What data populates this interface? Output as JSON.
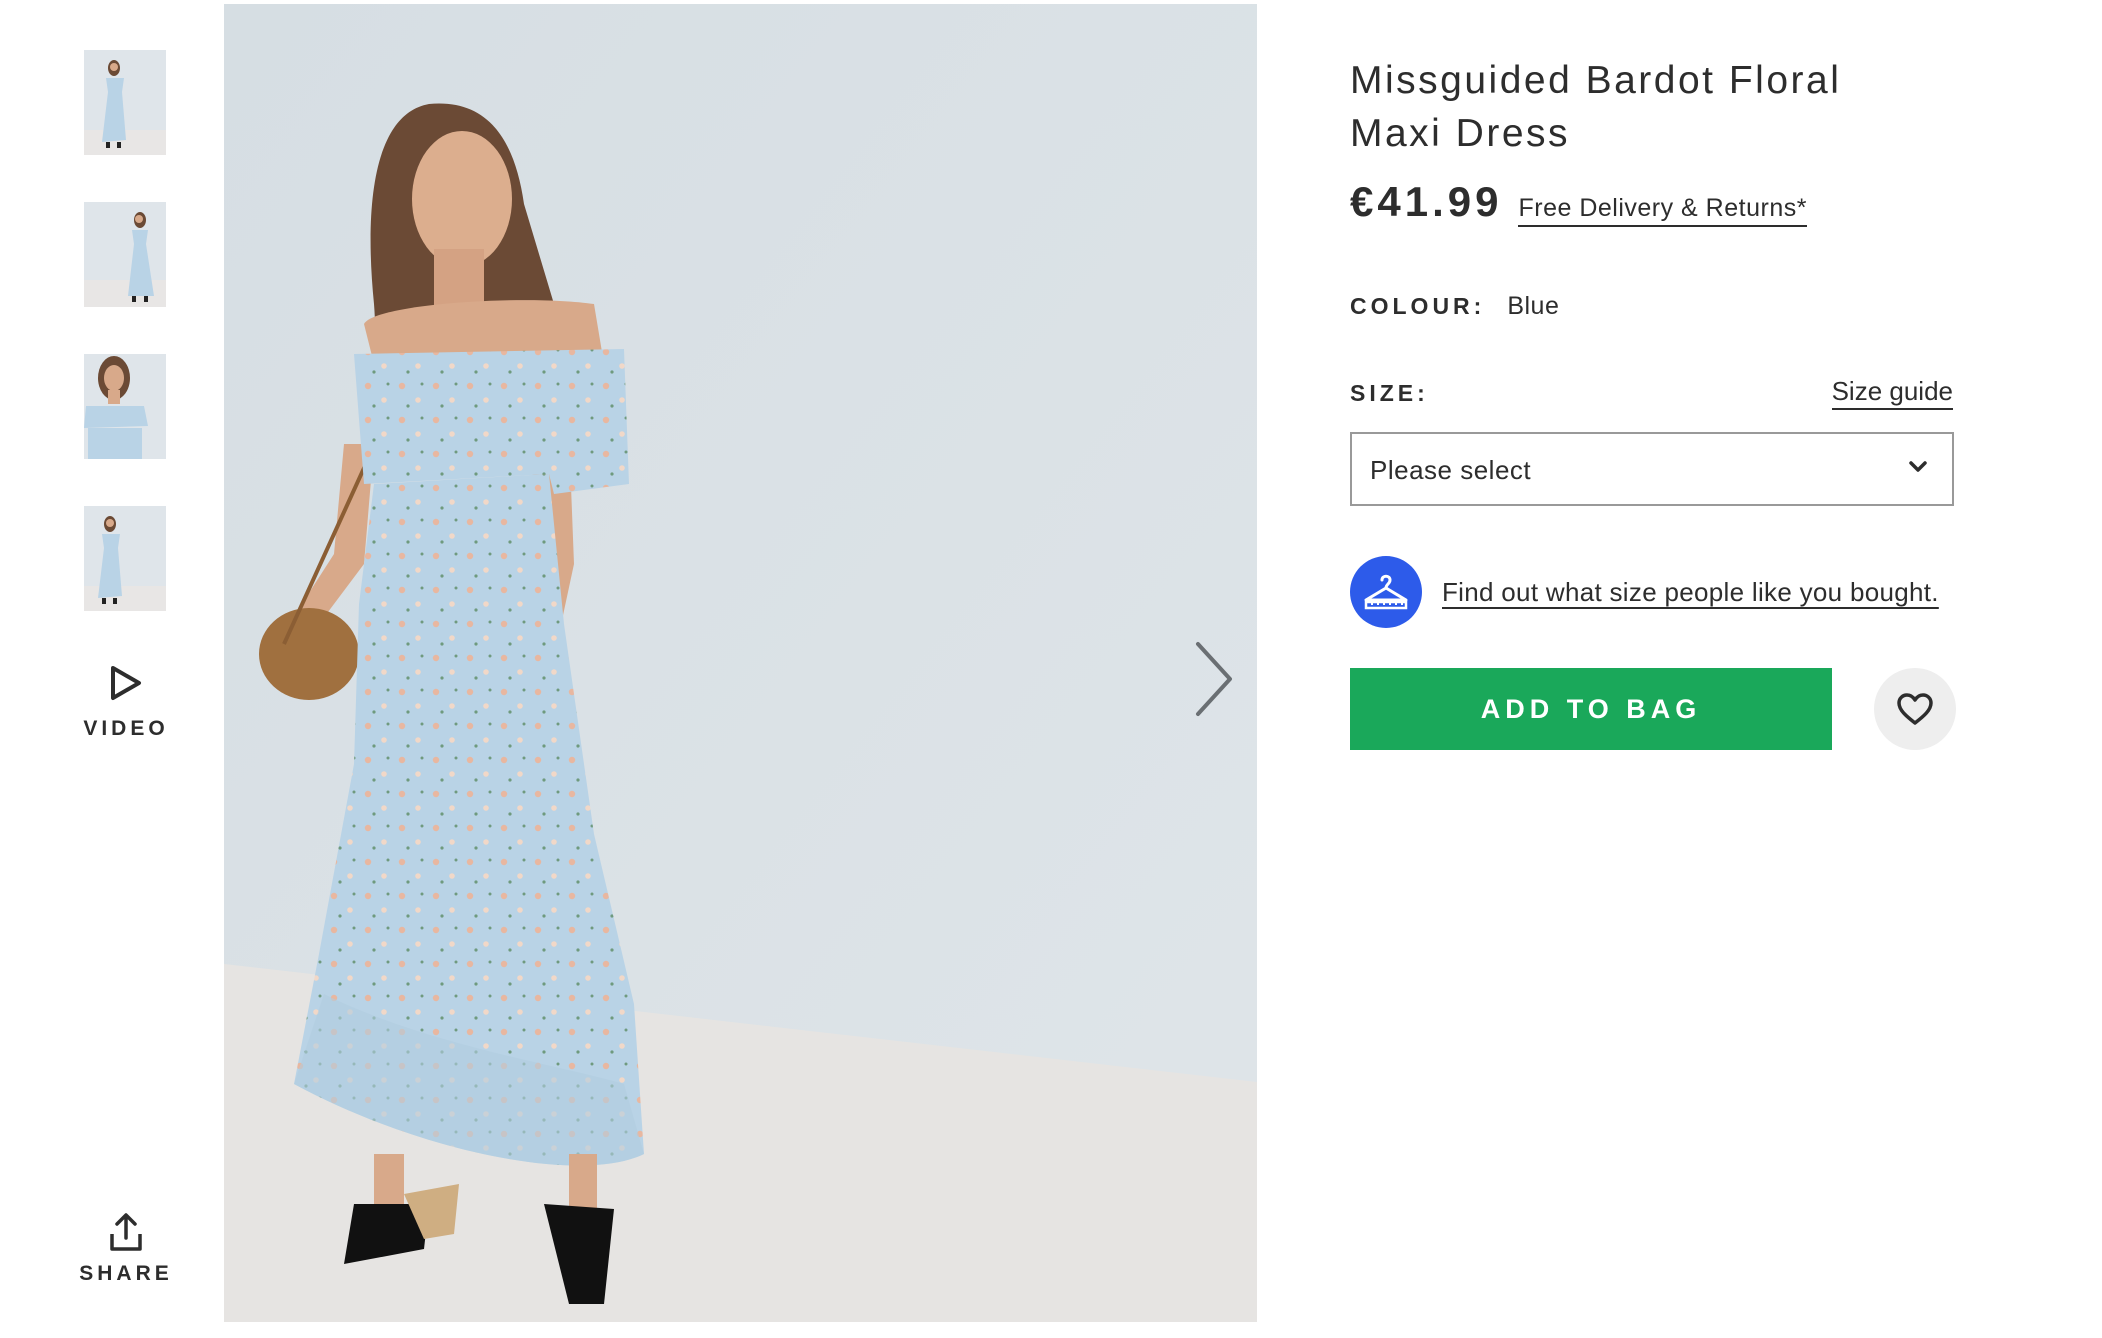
{
  "gallery": {
    "thumbnails": [
      {
        "alt": "thumbnail-1"
      },
      {
        "alt": "thumbnail-2"
      },
      {
        "alt": "thumbnail-3"
      },
      {
        "alt": "thumbnail-4"
      }
    ],
    "video_label": "VIDEO",
    "share_label": "SHARE",
    "video_icon": "play-icon",
    "share_icon": "share-icon",
    "next_icon": "chevron-right-icon"
  },
  "product": {
    "title": "Missguided Bardot Floral Maxi Dress",
    "price": "€41.99",
    "delivery_link": "Free Delivery & Returns*",
    "colour_label": "COLOUR:",
    "colour_value": "Blue",
    "size_label": "SIZE:",
    "size_guide_label": "Size guide",
    "size_placeholder": "Please select",
    "fit_link": "Find out what size people like you bought.",
    "fit_icon": "hanger-icon",
    "add_to_bag_label": "ADD TO BAG",
    "save_icon": "heart-icon"
  },
  "colors": {
    "add_to_bag_bg": "#1aa85a",
    "fit_icon_bg": "#2d5bea",
    "text": "#2d2d2d",
    "dress": "#b9d3e6",
    "backdrop": "#d9e1e6"
  }
}
